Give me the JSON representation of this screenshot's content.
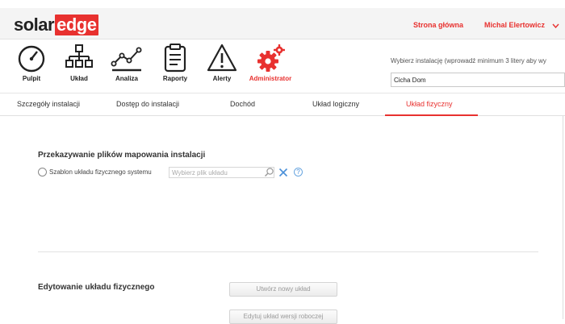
{
  "header": {
    "logo_text": "solar",
    "logo_highlight": "edge",
    "home_link": "Strona główna",
    "user_name": "Michal Elertowicz",
    "brand_color": "#e8312f"
  },
  "nav": {
    "items": [
      {
        "label": "Pulpit",
        "icon": "gauge-icon"
      },
      {
        "label": "Układ",
        "icon": "hierarchy-icon"
      },
      {
        "label": "Analiza",
        "icon": "line-chart-icon"
      },
      {
        "label": "Raporty",
        "icon": "clipboard-icon"
      },
      {
        "label": "Alerty",
        "icon": "warning-icon"
      },
      {
        "label": "Administrator",
        "icon": "gears-icon",
        "active": true
      }
    ]
  },
  "installation": {
    "label": "Wybierz instalację (wprowadź minimum 3 litery aby wy",
    "value": "Cicha Dom"
  },
  "tabs": [
    {
      "label": "Szczegóły instalacji"
    },
    {
      "label": "Dostęp do instalacji"
    },
    {
      "label": "Dochód"
    },
    {
      "label": "Układ logiczny"
    },
    {
      "label": "Układ fizyczny",
      "active": true
    }
  ],
  "mapping_section": {
    "title": "Przekazywanie plików mapowania instalacji",
    "radio_label": "Szablon układu fizycznego systemu",
    "file_placeholder": "Wybierz plik układu",
    "help_glyph": "?"
  },
  "edit_section": {
    "title": "Edytowanie układu fizycznego",
    "create_button": "Utwórz nowy układ",
    "edit_draft_button": "Edytuj układ wersji roboczej"
  }
}
